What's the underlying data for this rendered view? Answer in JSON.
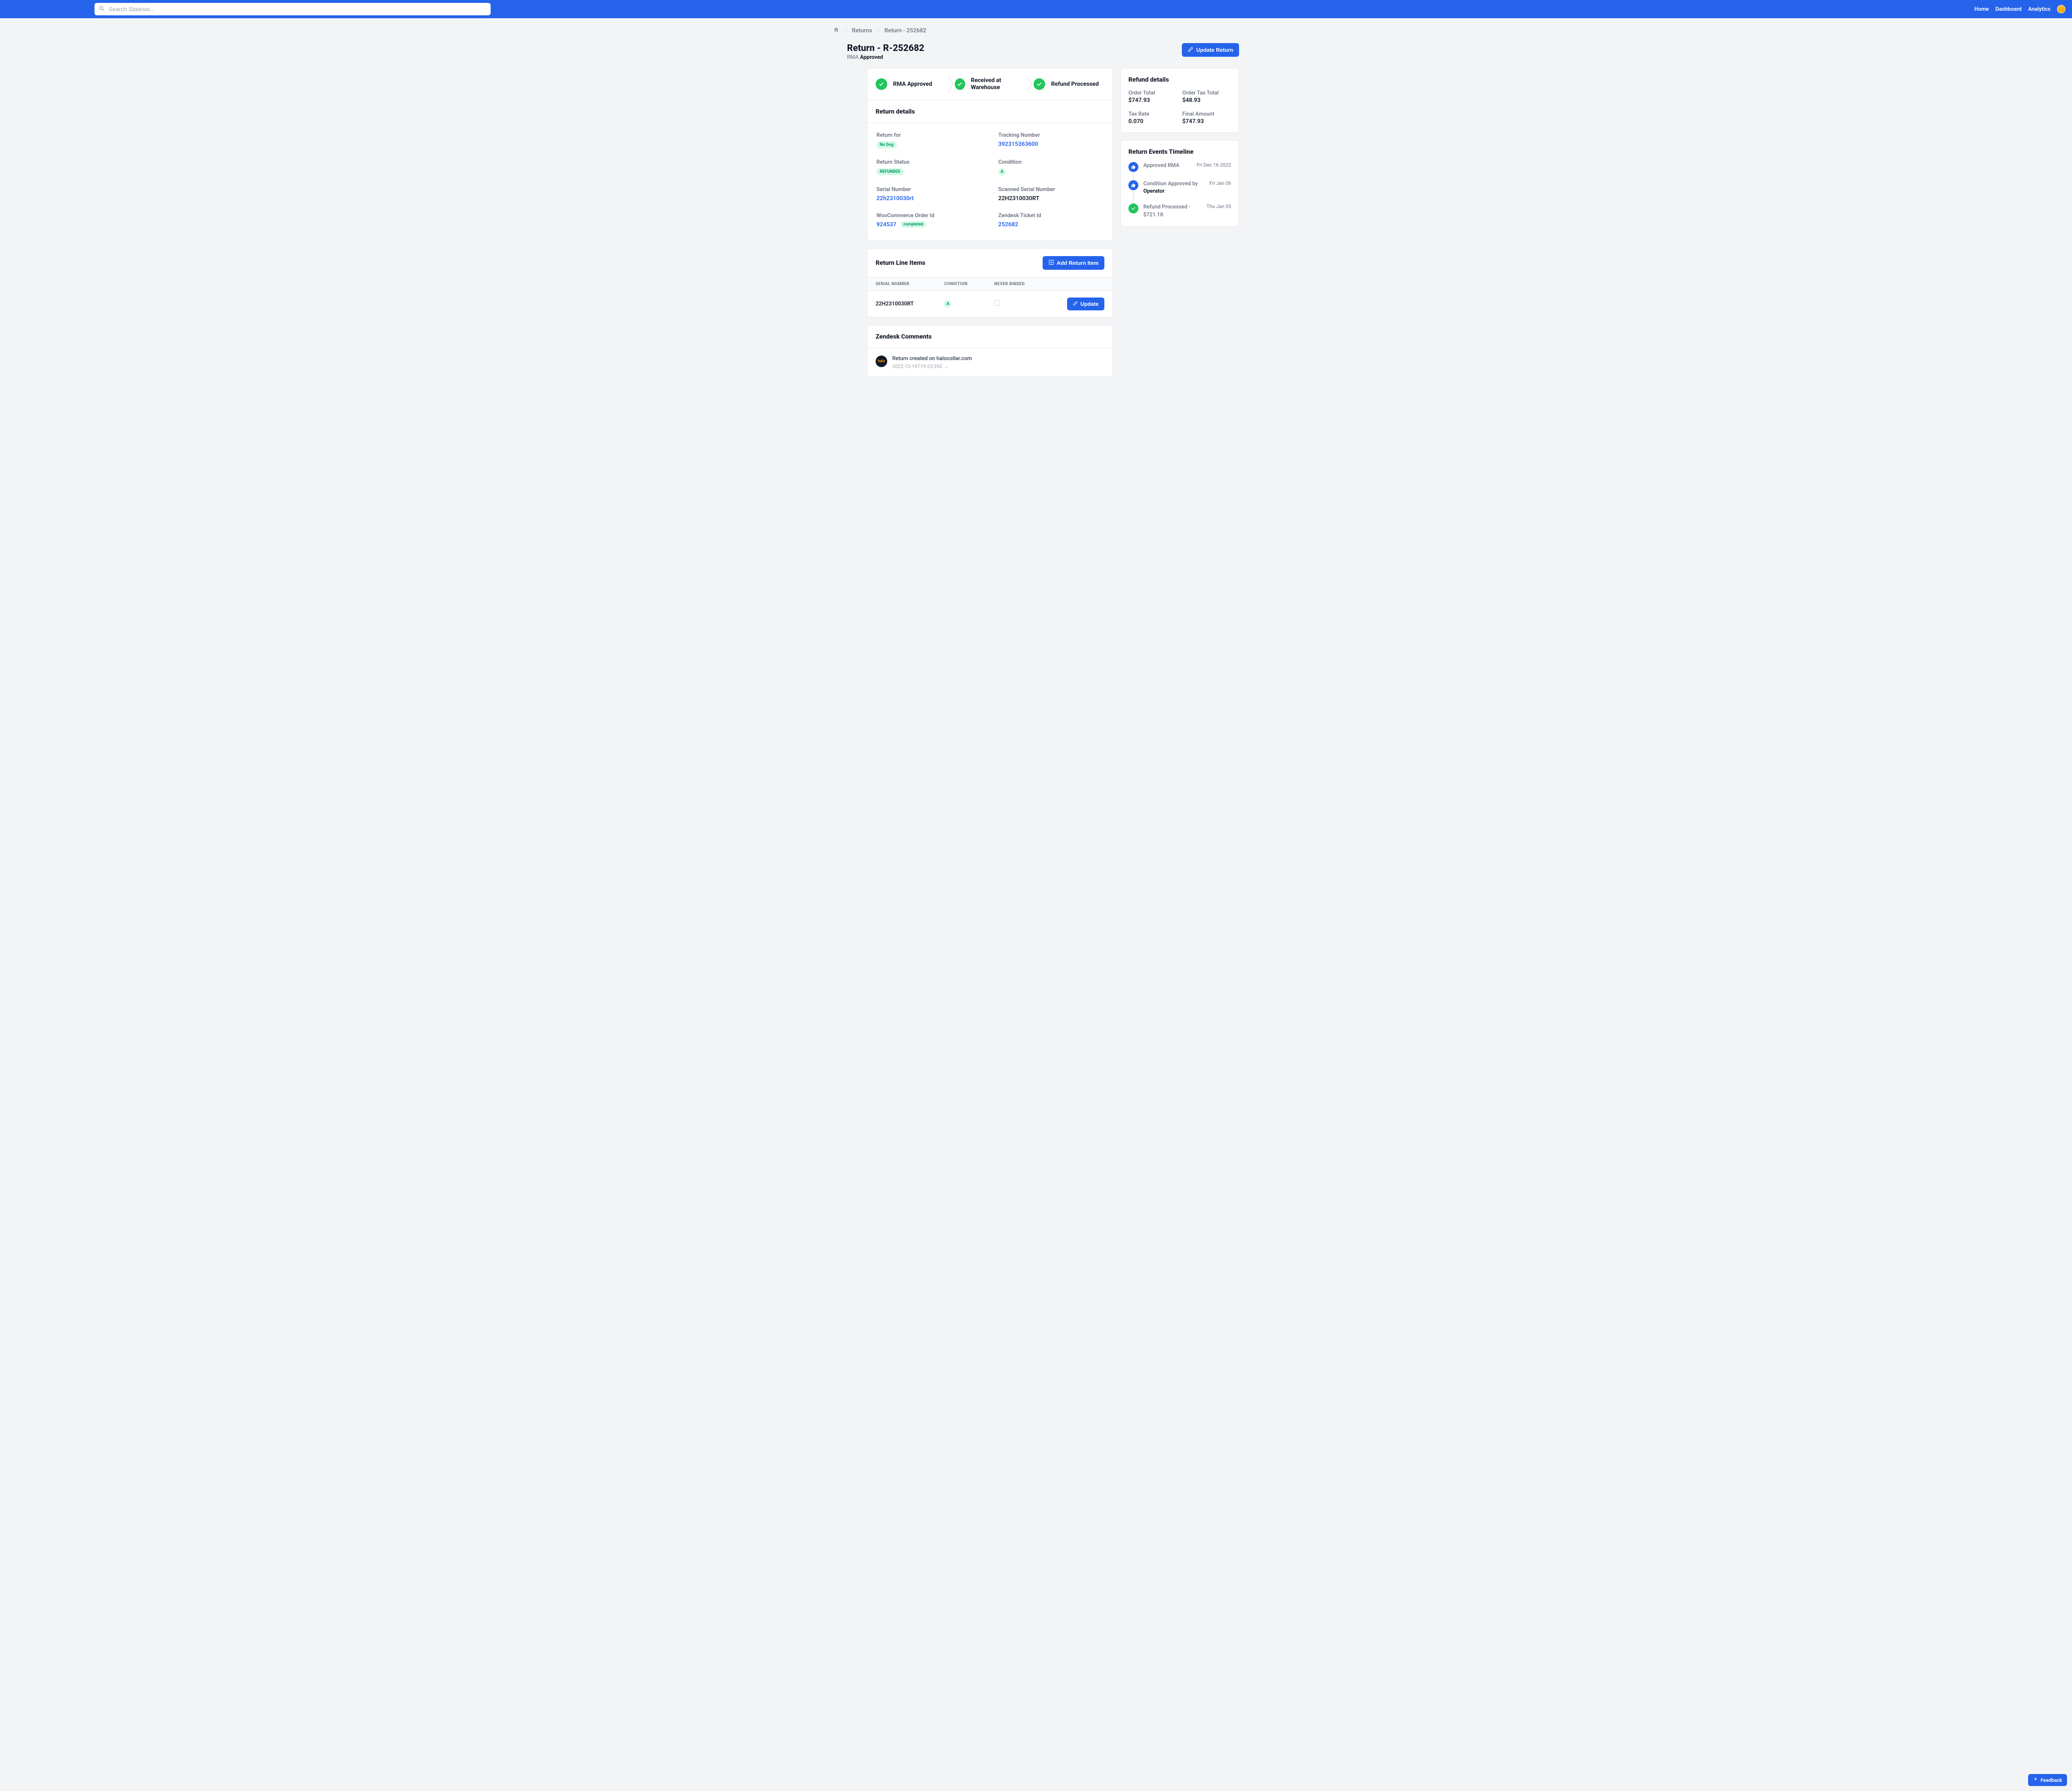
{
  "search": {
    "placeholder": "Search Stateset..."
  },
  "nav": {
    "home": "Home",
    "dashboard": "Dashboard",
    "analytics": "Analytics"
  },
  "breadcrumb": {
    "returns": "Returns",
    "current": "Return - 252682"
  },
  "page": {
    "title": "Return - R-252682",
    "sub_prefix": "RMA ",
    "sub_status": "Approved",
    "update_button": "Update Return"
  },
  "steps": [
    {
      "label": "RMA Approved"
    },
    {
      "label": "Received at Warehouse"
    },
    {
      "label": "Refund Processed"
    }
  ],
  "return_details": {
    "heading": "Return details",
    "return_for": {
      "label": "Return for",
      "badge": "No Dog"
    },
    "tracking": {
      "label": "Tracking Number",
      "value": "392315363600"
    },
    "status": {
      "label": "Return Status",
      "badge": "REFUNDED"
    },
    "condition": {
      "label": "Condition",
      "value": "A"
    },
    "serial": {
      "label": "Serial Number",
      "value": "22h2310030rt"
    },
    "scanned_serial": {
      "label": "Scanned Serial Number",
      "value": "22H2310030RT"
    },
    "woo": {
      "label": "WooCommerce Order Id",
      "value": "924537",
      "badge": "completed"
    },
    "zendesk": {
      "label": "Zendesk Ticket Id",
      "value": "252682"
    }
  },
  "line_items": {
    "heading": "Return Line Items",
    "add_button": "Add Return Item",
    "cols": {
      "serial": "SERIAL NUMBER",
      "condition": "CONDITION",
      "never_binded": "NEVER BINDED"
    },
    "rows": [
      {
        "serial": "22H2310030RT",
        "condition": "A",
        "never_binded": false,
        "update": "Update"
      }
    ]
  },
  "zendesk_comments": {
    "heading": "Zendesk Comments",
    "avatar_label": "halo",
    "items": [
      {
        "text": "Return created on halocollar.com",
        "date": "2022-12-16T19:23:39Z"
      }
    ]
  },
  "refund": {
    "heading": "Refund details",
    "order_total": {
      "label": "Order Total",
      "value": "$747.93"
    },
    "order_tax_total": {
      "label": "Order Tax Total",
      "value": "$48.93"
    },
    "tax_rate": {
      "label": "Tax Rate",
      "value": "0.070"
    },
    "final_amount": {
      "label": "Final Amount",
      "value": "$747.93"
    }
  },
  "timeline": {
    "heading": "Return Events Timeline",
    "items": [
      {
        "icon": "thumb",
        "text": "Approved RMA",
        "bold": "",
        "date": "Fri Dec 16 2022"
      },
      {
        "icon": "thumb",
        "text": "Condition Approved by",
        "bold": "Operator",
        "date": "Fri Jan 06"
      },
      {
        "icon": "check",
        "text": "Refund Processed - $721.18",
        "bold": "",
        "date": "Thu Jan 05"
      }
    ]
  },
  "feedback": {
    "label": "Feedback"
  },
  "colors": {
    "primary": "#2563eb",
    "success": "#22c55e",
    "badge_bg": "#d1fae5",
    "badge_fg": "#059669"
  }
}
